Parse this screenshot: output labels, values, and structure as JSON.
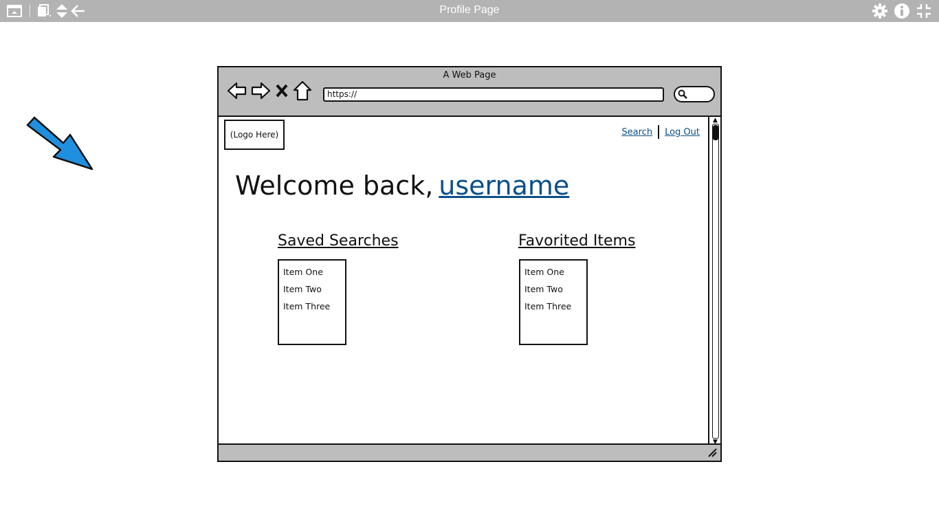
{
  "toolbar": {
    "title": "Profile Page",
    "icons": [
      "panel-icon",
      "pages-icon",
      "sort-icon",
      "back-arrow-icon",
      "gear-icon",
      "info-icon",
      "collapse-icon"
    ]
  },
  "browser": {
    "page_title": "A Web Page",
    "url": "https://",
    "nav_icons": [
      "back-icon",
      "forward-icon",
      "stop-icon",
      "home-icon"
    ]
  },
  "page": {
    "logo": "(Logo Here)",
    "links": {
      "search": "Search",
      "logout": "Log Out"
    },
    "welcome": {
      "prefix": "Welcome back,",
      "username": "username"
    },
    "saved_searches": {
      "title": "Saved Searches",
      "items": [
        "Item One",
        "Item Two",
        "Item Three"
      ]
    },
    "favorited_items": {
      "title": "Favorited Items",
      "items": [
        "Item One",
        "Item Two",
        "Item Three"
      ]
    }
  },
  "colors": {
    "toolbar_bg": "#b3b3b3",
    "link": "#0b4f8a",
    "arrow": "#1f8fe0"
  }
}
